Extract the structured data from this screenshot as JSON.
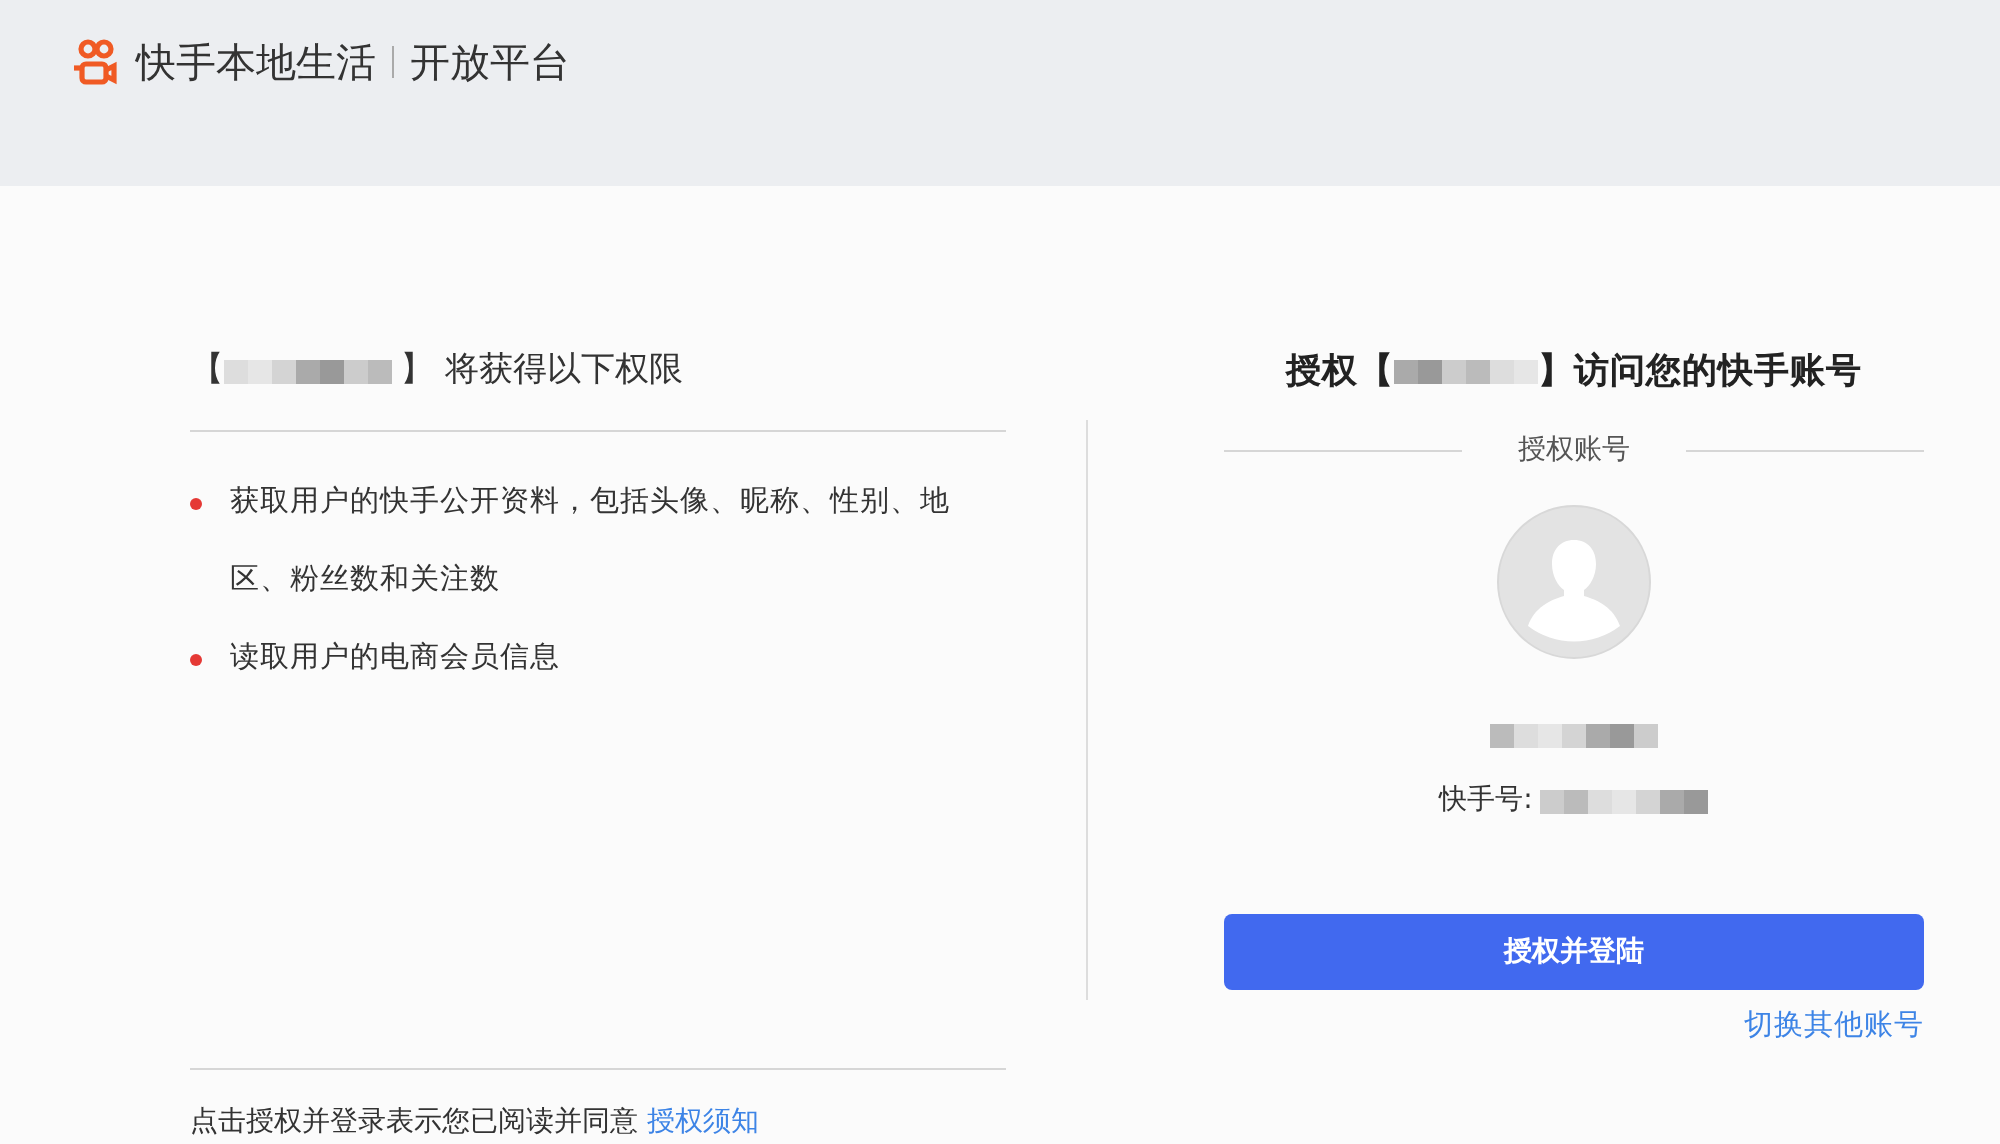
{
  "header": {
    "brand": "快手本地生活",
    "platform": "开放平台"
  },
  "permissions": {
    "title_before": "【",
    "title_after": "】 将获得以下权限",
    "items": [
      "获取用户的快手公开资料，包括头像、昵称、性别、地区、粉丝数和关注数",
      "读取用户的电商会员信息"
    ],
    "agreement": "点击授权并登录表示您已阅读并同意",
    "agreement_link": "授权须知"
  },
  "authorize": {
    "title_before": "授权【",
    "title_after": "】访问您的快手账号",
    "section": "授权账号",
    "id_label": "快手号:",
    "button": "授权并登陆",
    "switch_link": "切换其他账号"
  }
}
